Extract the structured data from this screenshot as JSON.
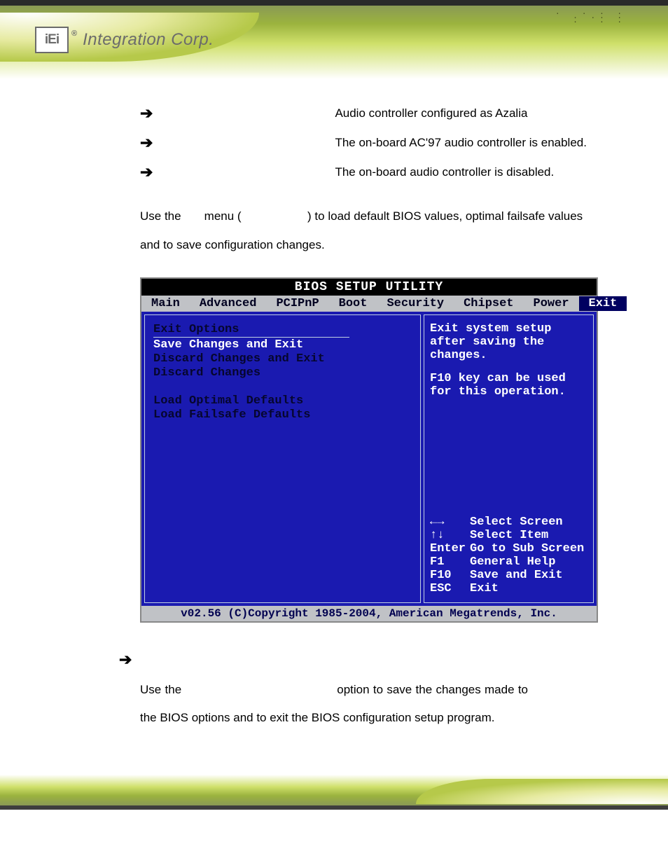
{
  "header": {
    "logo_abbr": "iEi",
    "registered": "®",
    "brand": "Integration Corp."
  },
  "bullets": [
    {
      "text": "Audio controller configured as Azalia"
    },
    {
      "text": "The on-board AC'97 audio controller is enabled."
    },
    {
      "text": "The on-board audio controller is disabled."
    }
  ],
  "intro": {
    "part1": "Use the ",
    "part2": " menu (",
    "part3": ") to load default BIOS values, optimal failsafe values and to save configuration changes."
  },
  "bios": {
    "title": "BIOS SETUP UTILITY",
    "tabs": [
      "Main",
      "Advanced",
      "PCIPnP",
      "Boot",
      "Security",
      "Chipset",
      "Power",
      "Exit"
    ],
    "active_tab": "Exit",
    "left": {
      "heading": "Exit Options",
      "items": [
        "Save Changes and Exit",
        "Discard Changes and Exit",
        "Discard Changes",
        "",
        "Load Optimal Defaults",
        "Load Failsafe Defaults"
      ],
      "selected_index": 0
    },
    "right": {
      "help1": "Exit system setup after saving the changes.",
      "help2": "F10 key can be used for this operation.",
      "keys": [
        {
          "k": "←→",
          "d": "Select Screen"
        },
        {
          "k": "↑↓",
          "d": "Select Item"
        },
        {
          "k": "Enter",
          "d": "Go to Sub Screen"
        },
        {
          "k": "F1",
          "d": "General Help"
        },
        {
          "k": "F10",
          "d": "Save and Exit"
        },
        {
          "k": "ESC",
          "d": "Exit"
        }
      ]
    },
    "footer": "v02.56 (C)Copyright 1985-2004, American Megatrends, Inc."
  },
  "save_section": {
    "part1": "Use the ",
    "part2": " option to save the changes made to the BIOS options and to exit the BIOS configuration setup program."
  }
}
